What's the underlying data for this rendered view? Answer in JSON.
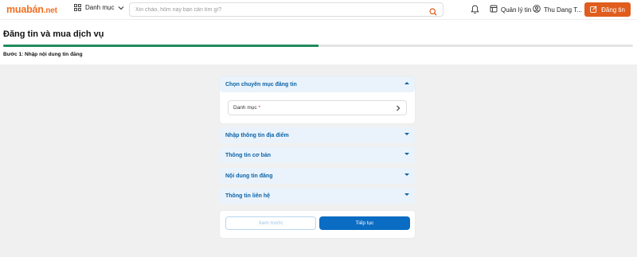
{
  "header": {
    "logo_main": "muabán",
    "logo_tld": ".net",
    "menu_label": "Danh mục",
    "search_placeholder": "Xin chào, hôm nay bạn cần tìm gì?",
    "manage_label": "Quản lý tin",
    "user_name": "Thu Dang T...",
    "post_button": "Đăng tin",
    "brand_color": "#f37021",
    "post_button_color": "#e05d1d"
  },
  "page": {
    "title": "Đăng tin và mua dịch vụ",
    "progress": 0.5,
    "step_label": "Bước 1:  Nhập nội dung tin đăng",
    "progress_color": "#1f8a5b"
  },
  "sections": [
    {
      "label": "Chọn chuyên mục đăng tin",
      "expanded": true
    },
    {
      "label": "Nhập thông tin địa điểm",
      "expanded": false
    },
    {
      "label": "Thông tin cơ bản",
      "expanded": false
    },
    {
      "label": "Nội dung tin đăng",
      "expanded": false
    },
    {
      "label": "Thông tin liên hệ",
      "expanded": false
    }
  ],
  "category_field": {
    "label": "Danh mục",
    "required_mark": "*"
  },
  "actions": {
    "prev": "Xem trước",
    "next": "Tiếp tục",
    "accent": "#0a6cc2"
  }
}
